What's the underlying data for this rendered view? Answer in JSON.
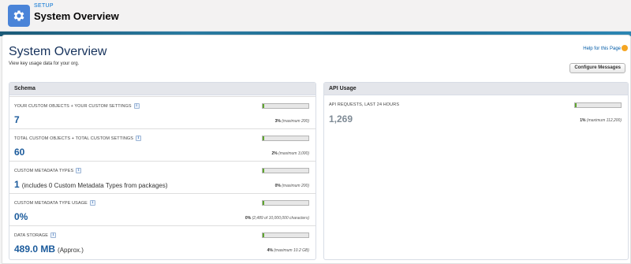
{
  "header": {
    "eyebrow": "SETUP",
    "title": "System Overview",
    "icon": "gear-icon"
  },
  "page": {
    "title": "System Overview",
    "description": "View key usage data for your org.",
    "help_link": "Help for this Page",
    "configure_button": "Configure Messages"
  },
  "schema": {
    "title": "Schema",
    "rows": [
      {
        "label": "YOUR CUSTOM OBJECTS + YOUR CUSTOM SETTINGS",
        "value": "7",
        "value_note": "",
        "percent_text": "3%",
        "max_text": "(maximum 200)",
        "usage_fraction": 0.03
      },
      {
        "label": "TOTAL CUSTOM OBJECTS + TOTAL CUSTOM SETTINGS",
        "value": "60",
        "value_note": "",
        "percent_text": "2%",
        "max_text": "(maximum 3,000)",
        "usage_fraction": 0.02
      },
      {
        "label": "CUSTOM METADATA TYPES",
        "value": "1",
        "value_note": "(includes 0 Custom Metadata Types from packages)",
        "percent_text": "0%",
        "max_text": "(maximum 200)",
        "usage_fraction": 0.0
      },
      {
        "label": "CUSTOM METADATA TYPE USAGE",
        "value": "0%",
        "value_note": "",
        "percent_text": "0%",
        "max_text": "(2,489 of 10,000,000 characters)",
        "usage_fraction": 0.0
      },
      {
        "label": "DATA STORAGE",
        "value": "489.0 MB",
        "value_note": "(Approx.)",
        "percent_text": "4%",
        "max_text": "(maximum 10.2 GB)",
        "usage_fraction": 0.04
      }
    ]
  },
  "api": {
    "title": "API Usage",
    "rows": [
      {
        "label": "API REQUESTS, LAST 24 HOURS",
        "value": "1,269",
        "percent_text": "1%",
        "max_text": "(maximum 112,200)",
        "usage_fraction": 0.01
      }
    ]
  },
  "colors": {
    "accent": "#0070d2",
    "value_blue": "#1a5a9b",
    "bar_fill": "#5fa52f"
  }
}
